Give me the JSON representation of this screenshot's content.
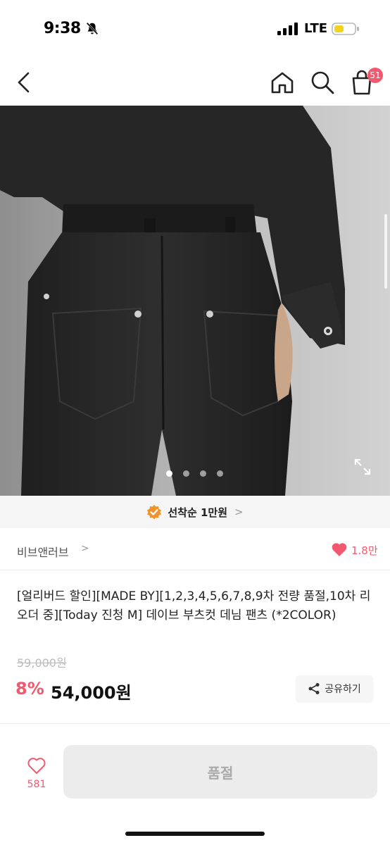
{
  "status_bar": {
    "time": "9:38",
    "network": "LTE",
    "icons": [
      "bell-slash-icon",
      "signal-icon",
      "battery-icon"
    ]
  },
  "header": {
    "icons": [
      "back-icon",
      "home-icon",
      "search-icon",
      "cart-icon"
    ],
    "cart_count": "51"
  },
  "gallery": {
    "image_alt": "product photo",
    "dot_count": 4,
    "active_index": 0
  },
  "promo": {
    "text": "선착순 1만원",
    "chevron": ">"
  },
  "brand": {
    "name": "비브앤러브",
    "chevron": ">",
    "likes": "1.8만"
  },
  "product": {
    "title": "[얼리버드 할인][MADE BY][1,2,3,4,5,6,7,8,9차 전량 품절,10차 리오더 중][Today 진청 M] 데이브 부츠컷 데님 팬츠 (*2COLOR)",
    "original_price": "59,000원",
    "discount": "8%",
    "price": "54,000원",
    "share_label": "공유하기"
  },
  "bottom_bar": {
    "wish_count": "581",
    "cta_label": "품절"
  },
  "colors": {
    "accent": "#f2596e",
    "promo_badge": "#f0932b",
    "soldout_bg": "#ececec"
  }
}
